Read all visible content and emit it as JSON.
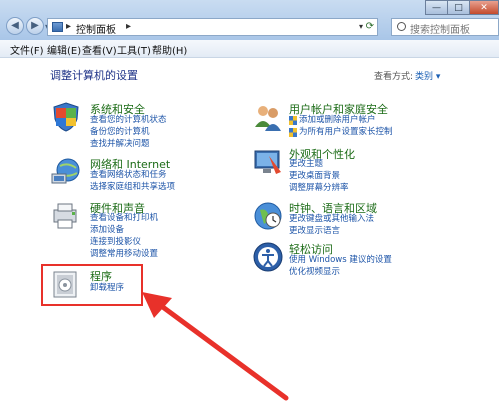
{
  "window": {
    "address_path": "控制面板",
    "search_placeholder": "搜索控制面板",
    "min_glyph": "—",
    "max_glyph": "□",
    "close_glyph": "✕"
  },
  "menu": [
    "文件(F)",
    "编辑(E)",
    "查看(V)",
    "工具(T)",
    "帮助(H)"
  ],
  "page": {
    "heading": "调整计算机的设置",
    "view_by_label": "查看方式:",
    "view_by_value": "类别 ▾"
  },
  "categories": {
    "system": {
      "title": "系统和安全",
      "links": [
        "查看您的计算机状态",
        "备份您的计算机",
        "查找并解决问题"
      ]
    },
    "network": {
      "title": "网络和 Internet",
      "links": [
        "查看网络状态和任务",
        "选择家庭组和共享选项"
      ]
    },
    "hardware": {
      "title": "硬件和声音",
      "links": [
        "查看设备和打印机",
        "添加设备",
        "连接到投影仪",
        "调整常用移动设置"
      ]
    },
    "programs": {
      "title": "程序",
      "links": [
        "卸载程序"
      ]
    },
    "users": {
      "title": "用户帐户和家庭安全",
      "links": [
        "添加或删除用户帐户",
        "为所有用户设置家长控制"
      ]
    },
    "appearance": {
      "title": "外观和个性化",
      "links": [
        "更改主题",
        "更改桌面背景",
        "调整屏幕分辨率"
      ]
    },
    "clock": {
      "title": "时钟、语言和区域",
      "links": [
        "更改键盘或其他输入法",
        "更改显示语言"
      ]
    },
    "ease": {
      "title": "轻松访问",
      "links": [
        "使用 Windows 建议的设置",
        "优化视频显示"
      ]
    }
  },
  "annotation_color": "#e8312a",
  "icons": [
    "back-icon",
    "forward-icon",
    "control-panel-icon",
    "refresh-icon",
    "search-icon",
    "system-security-icon",
    "network-icon",
    "hardware-sound-icon",
    "programs-icon",
    "users-icon",
    "appearance-icon",
    "clock-region-icon",
    "ease-of-access-icon",
    "uac-shield-icon"
  ]
}
